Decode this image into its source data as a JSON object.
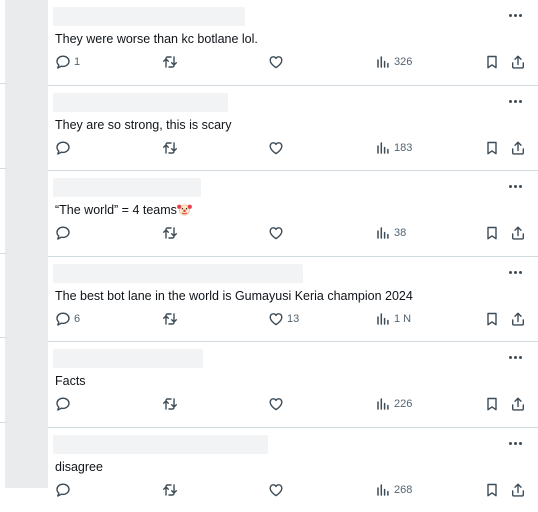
{
  "replies": [
    {
      "text": "They were worse than kc botlane lol.",
      "reply_count": "1",
      "retweet_count": "",
      "like_count": "",
      "view_count": "326"
    },
    {
      "text": "They are so strong, this is scary",
      "reply_count": "",
      "retweet_count": "",
      "like_count": "",
      "view_count": "183"
    },
    {
      "text": "“The world” = 4 teams",
      "reply_count": "",
      "retweet_count": "",
      "like_count": "",
      "view_count": "38"
    },
    {
      "text": "The best bot lane in the world is Gumayusi Keria champion 2024",
      "reply_count": "6",
      "retweet_count": "",
      "like_count": "13",
      "view_count": "1 N"
    },
    {
      "text": "Facts",
      "reply_count": "",
      "retweet_count": "",
      "like_count": "",
      "view_count": "226"
    },
    {
      "text": "disagree",
      "reply_count": "",
      "retweet_count": "",
      "like_count": "",
      "view_count": "268"
    }
  ],
  "icons": {
    "reply": "reply-icon",
    "retweet": "retweet-icon",
    "like": "heart-icon",
    "views": "views-icon",
    "bookmark": "bookmark-icon",
    "share": "share-icon",
    "more": "more-options-icon",
    "emoji": "clown-face-emoji"
  },
  "colors": {
    "icon": "#536471",
    "text": "#0f1419",
    "divider": "#cfd9de"
  }
}
